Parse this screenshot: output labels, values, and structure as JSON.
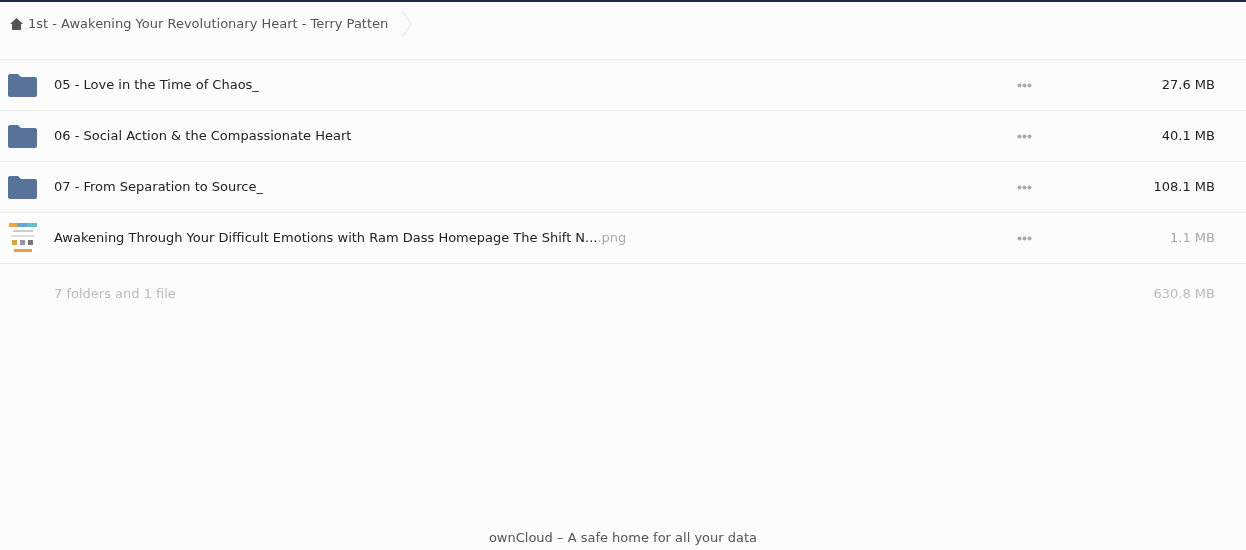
{
  "breadcrumb": {
    "label": "1st - Awakening Your Revolutionary Heart - Terry Patten"
  },
  "files": [
    {
      "kind": "folder",
      "name": "05 - Love in the Time of Chaos_",
      "size": "27.6 MB",
      "faded": false
    },
    {
      "kind": "folder",
      "name": "06 - Social Action & the Compassionate Heart",
      "size": "40.1 MB",
      "faded": false
    },
    {
      "kind": "folder",
      "name": "07 - From Separation to Source_",
      "size": "108.1 MB",
      "faded": false
    },
    {
      "kind": "image",
      "name": "Awakening Through Your Difficult Emotions with Ram Dass Homepage The Shift N...",
      "extension": ".png",
      "size": "1.1 MB",
      "faded": true
    }
  ],
  "summary": {
    "label": "7 folders and 1 file",
    "size": "630.8 MB"
  },
  "footer": "ownCloud – A safe home for all your data"
}
